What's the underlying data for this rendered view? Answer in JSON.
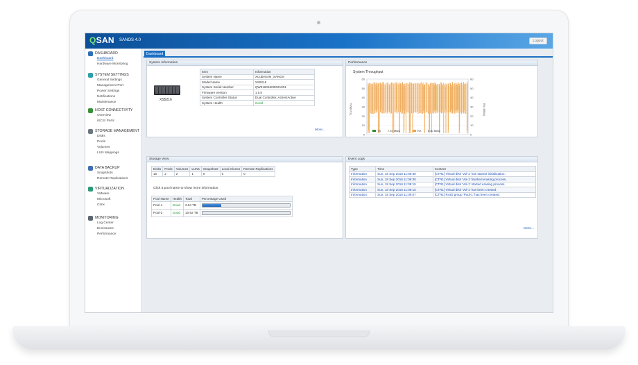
{
  "brand": {
    "logo_q": "Q",
    "logo_rest": "SAN",
    "version": "SANOS 4.0"
  },
  "header": {
    "logout_label": "Logout"
  },
  "sidebar": [
    {
      "title": "DASHBOARD",
      "color": "#2d6fb7",
      "items": [
        {
          "label": "Dashboard",
          "active": true
        },
        {
          "label": "Hardware Monitoring"
        }
      ]
    },
    {
      "title": "SYSTEM SETTINGS",
      "color": "#2aa0a8",
      "items": [
        {
          "label": "General Settings"
        },
        {
          "label": "Management Port"
        },
        {
          "label": "Power Settings"
        },
        {
          "label": "Notifications"
        },
        {
          "label": "Maintenance"
        }
      ]
    },
    {
      "title": "HOST CONNECTIVITY",
      "color": "#3b8f3a",
      "items": [
        {
          "label": "Overview"
        },
        {
          "label": "iSCSI Ports"
        }
      ]
    },
    {
      "title": "STORAGE MANAGEMENT",
      "color": "#6d7780",
      "items": [
        {
          "label": "Disks"
        },
        {
          "label": "Pools"
        },
        {
          "label": "Volumes"
        },
        {
          "label": "LUN Mappings"
        }
      ]
    },
    {
      "title": "DATA BACKUP",
      "color": "#3f6fb0",
      "items": [
        {
          "label": "Snapshots"
        },
        {
          "label": "Remote Replications"
        }
      ]
    },
    {
      "title": "VIRTUALIZATION",
      "color": "#2a9a7a",
      "items": [
        {
          "label": "VMware"
        },
        {
          "label": "Microsoft"
        },
        {
          "label": "Citrix"
        }
      ]
    },
    {
      "title": "MONITORING",
      "color": "#5b6570",
      "items": [
        {
          "label": "Log Center"
        },
        {
          "label": "Enclosures"
        },
        {
          "label": "Performance"
        }
      ]
    }
  ],
  "tabs": [
    {
      "label": "Dashboard"
    }
  ],
  "system_info": {
    "title": "System Information",
    "device_label": "XS5216",
    "headers": [
      "Item",
      "Information"
    ],
    "rows": [
      [
        "System Name",
        "XCubeSAN_SANOS"
      ],
      [
        "Model Name",
        "XS5216"
      ],
      [
        "System Serial Number",
        "QW3160160I0021001"
      ],
      [
        "Firmware Version",
        "1.0.0"
      ],
      [
        "System Controller Status",
        "Dual Controller, Active/Active"
      ],
      [
        "System Health",
        "Good"
      ]
    ],
    "more": "More..."
  },
  "performance": {
    "title": "Performance",
    "chart_title": "System Throughput",
    "y_left_label": "TX (MB/s)",
    "y_right_label": "RX (MB/s)",
    "y_ticks": [
      "60",
      "50",
      "40",
      "30",
      "20",
      "10",
      "0"
    ],
    "legend": [
      {
        "name": "TX",
        "value": "7.57 MB/s",
        "color": "#2e8b2e"
      },
      {
        "name": "RX",
        "value": "6.50 MB/s",
        "color": "#f0a24a"
      }
    ]
  },
  "storage_view": {
    "title": "Storage View",
    "summary_headers": [
      "Disks",
      "Pools",
      "Volumes",
      "LUNs",
      "Snapshots",
      "Local Clones",
      "Remote Replications"
    ],
    "summary_values": [
      "16",
      "2",
      "2",
      "1",
      "0",
      "0",
      "0"
    ],
    "hint": "Click a pool name to show more information.",
    "pool_headers": [
      "Pool Name",
      "Health",
      "Total",
      "Percentage Used"
    ],
    "pools": [
      {
        "name": "Pool-1",
        "health": "Good",
        "total": "3.64 TB",
        "used_pct": 22
      },
      {
        "name": "Pool-2",
        "health": "Good",
        "total": "10.92 TB",
        "used_pct": 0
      }
    ]
  },
  "event_logs": {
    "title": "Event Logs",
    "headers": [
      "Type",
      "Time",
      "Content"
    ],
    "rows": [
      [
        "Information",
        "Sun, 18 Sep 2016 11:09:30",
        "[CTR1] Virtual disk 'Vol-1' has started initialization."
      ],
      [
        "Information",
        "Sun, 18 Sep 2016 11:09:30",
        "[CTR1] Virtual disk 'Vol-1' finished erasing process."
      ],
      [
        "Information",
        "Sun, 18 Sep 2016 11:09:15",
        "[CTR1] Virtual disk 'Vol-1' started erasing process."
      ],
      [
        "Information",
        "Sun, 18 Sep 2016 11:09:15",
        "[CTR1] Virtual disk 'Vol-1' has been created."
      ],
      [
        "Information",
        "Sun, 18 Sep 2016 11:09:07",
        "[CTR1] RAID group 'Pool-1' has been created."
      ]
    ],
    "more": "More..."
  }
}
